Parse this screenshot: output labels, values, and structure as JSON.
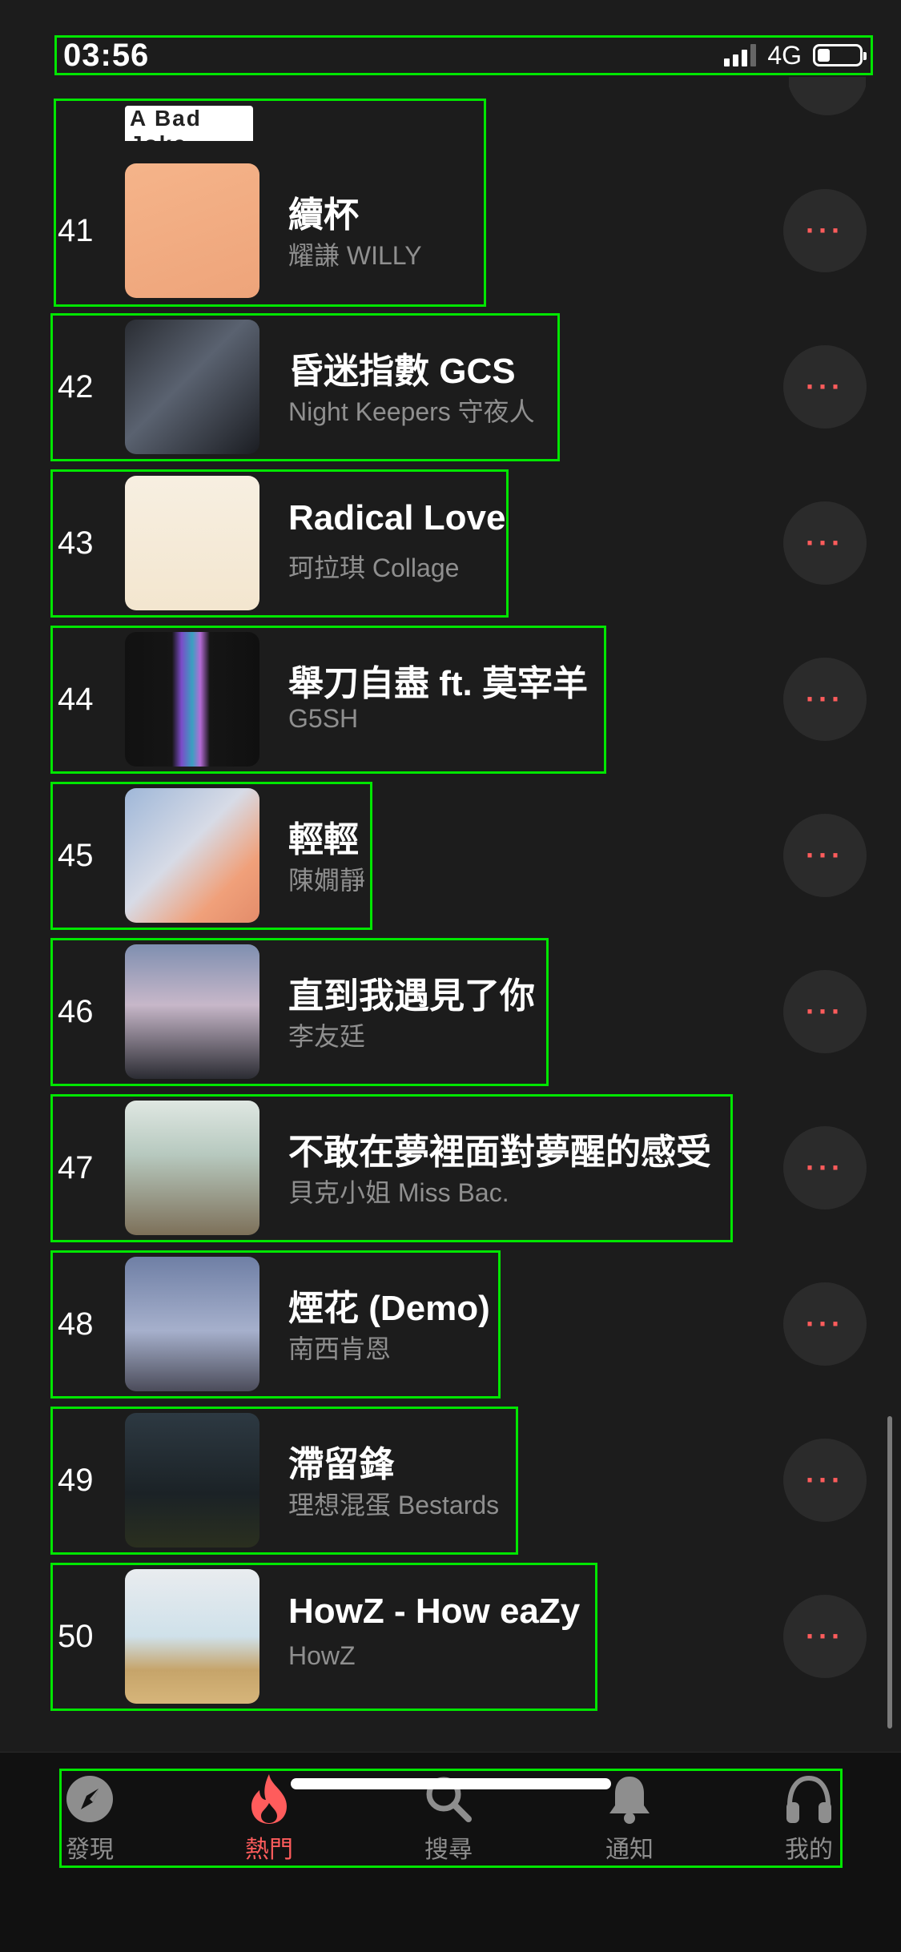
{
  "status_bar": {
    "time": "03:56",
    "network": "4G",
    "battery_percent": 30
  },
  "rows": [
    {
      "rank": "41",
      "title": "續杯",
      "artist": "耀謙 WILLY",
      "box_width": 540
    },
    {
      "rank": "42",
      "title": "昏迷指數 GCS",
      "artist": "Night Keepers 守夜人",
      "box_width": 636
    },
    {
      "rank": "43",
      "title": "Radical Love",
      "artist": "珂拉琪 Collage",
      "box_width": 572
    },
    {
      "rank": "44",
      "title": "舉刀自盡 ft. 莫宰羊",
      "artist": "G5SH",
      "box_width": 694
    },
    {
      "rank": "45",
      "title": "輕輕",
      "artist": "陳嫺靜",
      "box_width": 402
    },
    {
      "rank": "46",
      "title": "直到我遇見了你",
      "artist": "李友廷",
      "box_width": 622
    },
    {
      "rank": "47",
      "title": "不敢在夢裡面對夢醒的感受",
      "artist": "貝克小姐 Miss Bac.",
      "box_width": 852
    },
    {
      "rank": "48",
      "title": "煙花 (Demo)",
      "artist": "南西肯恩",
      "box_width": 562
    },
    {
      "rank": "49",
      "title": "滯留鋒",
      "artist": "理想混蛋 Bestards",
      "box_width": 584
    },
    {
      "rank": "50",
      "title": "HowZ - How eaZy",
      "artist": "HowZ",
      "box_width": 683
    }
  ],
  "more_label": "···",
  "partial_top_cover_text": "A Bad Joke",
  "tabs": [
    {
      "label": "發現",
      "icon": "compass-icon",
      "active": false
    },
    {
      "label": "熱門",
      "icon": "flame-icon",
      "active": true
    },
    {
      "label": "搜尋",
      "icon": "search-icon",
      "active": false
    },
    {
      "label": "通知",
      "icon": "bell-icon",
      "active": false
    },
    {
      "label": "我的",
      "icon": "headphones-icon",
      "active": false
    }
  ],
  "colors": {
    "accent": "#ff5c5c",
    "background": "#1c1c1c",
    "annotation_box": "#00e600"
  }
}
